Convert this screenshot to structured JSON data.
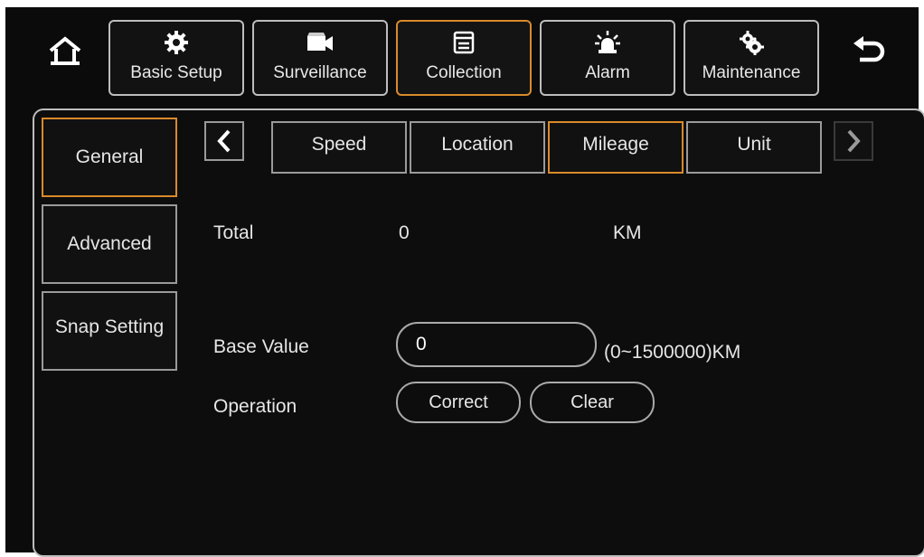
{
  "nav": {
    "tabs": [
      {
        "label": "Basic Setup",
        "icon": "gear-icon"
      },
      {
        "label": "Surveillance",
        "icon": "camera-icon"
      },
      {
        "label": "Collection",
        "icon": "document-icon"
      },
      {
        "label": "Alarm",
        "icon": "siren-icon"
      },
      {
        "label": "Maintenance",
        "icon": "gears-icon"
      }
    ],
    "active_tab": "Collection"
  },
  "sidebar": {
    "items": [
      {
        "label": "General"
      },
      {
        "label": "Advanced"
      },
      {
        "label": "Snap Setting"
      }
    ],
    "active": "General"
  },
  "subtabs": {
    "items": [
      {
        "label": "Speed"
      },
      {
        "label": "Location"
      },
      {
        "label": "Mileage"
      },
      {
        "label": "Unit"
      }
    ],
    "active": "Mileage"
  },
  "mileage": {
    "total_label": "Total",
    "total_value": "0",
    "total_unit": "KM",
    "base_label": "Base Value",
    "base_value": "0",
    "base_range": "(0~1500000)KM",
    "operation_label": "Operation",
    "correct_label": "Correct",
    "clear_label": "Clear"
  },
  "colors": {
    "background": "#0b0b0b",
    "accent": "#d98a2b",
    "border": "#bdbdbd"
  }
}
